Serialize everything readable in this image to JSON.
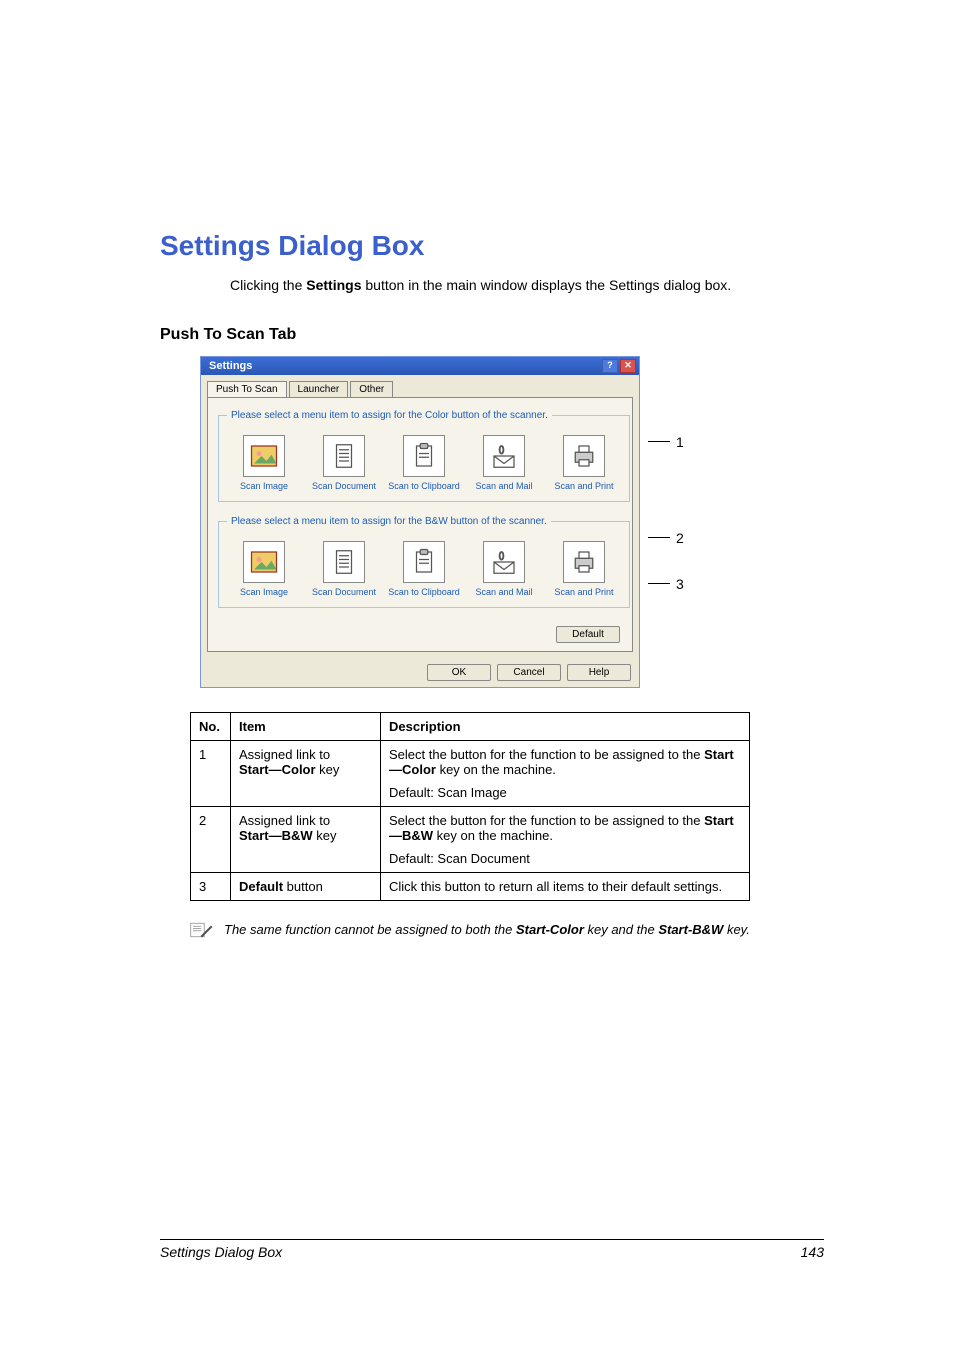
{
  "title": "Settings Dialog Box",
  "intro_pre": "Clicking the ",
  "intro_bold": "Settings",
  "intro_post": " button in the main window displays the Settings dialog box.",
  "subhead": "Push To Scan Tab",
  "dialog": {
    "title": "Settings",
    "tabs": [
      "Push To Scan",
      "Launcher",
      "Other"
    ],
    "group_color_legend": "Please select a menu item to assign for the Color button of the scanner.",
    "group_bw_legend": "Please select a menu item to assign for the B&W button of the scanner.",
    "items": [
      {
        "label": "Scan Image",
        "icon": "image"
      },
      {
        "label": "Scan Document",
        "icon": "doc"
      },
      {
        "label": "Scan to Clipboard",
        "icon": "clip"
      },
      {
        "label": "Scan and Mail",
        "icon": "mail"
      },
      {
        "label": "Scan and Print",
        "icon": "print"
      }
    ],
    "default": "Default",
    "ok": "OK",
    "cancel": "Cancel",
    "help": "Help"
  },
  "callouts": [
    "1",
    "2",
    "3"
  ],
  "table": {
    "headers": {
      "no": "No.",
      "item": "Item",
      "desc": "Description"
    },
    "rows": [
      {
        "no": "1",
        "item_line1": "Assigned link to",
        "item_bold": "Start—Color",
        "item_after": " key",
        "desc_line1_pre": "Select the button for the function to be assigned to the ",
        "desc_line1_bold": "Start—Color",
        "desc_line1_post": " key on the machine.",
        "desc_default": "Default: Scan Image"
      },
      {
        "no": "2",
        "item_line1": "Assigned link to",
        "item_bold": "Start—B&W",
        "item_after": " key",
        "desc_line1_pre": "Select the button for the function to be assigned to the ",
        "desc_line1_bold": "Start—B&W",
        "desc_line1_post": " key on the machine.",
        "desc_default": "Default: Scan Document"
      },
      {
        "no": "3",
        "item_line1": "",
        "item_bold": "Default",
        "item_after": " button",
        "desc_line1_pre": "Click this button to return all items to their default settings.",
        "desc_line1_bold": "",
        "desc_line1_post": "",
        "desc_default": ""
      }
    ]
  },
  "note_pre": "The same function cannot be assigned to both the ",
  "note_b1": "Start-Color",
  "note_mid": " key and the ",
  "note_b2": "Start-B&W",
  "note_post": " key.",
  "footer_left": "Settings Dialog Box",
  "footer_right": "143"
}
